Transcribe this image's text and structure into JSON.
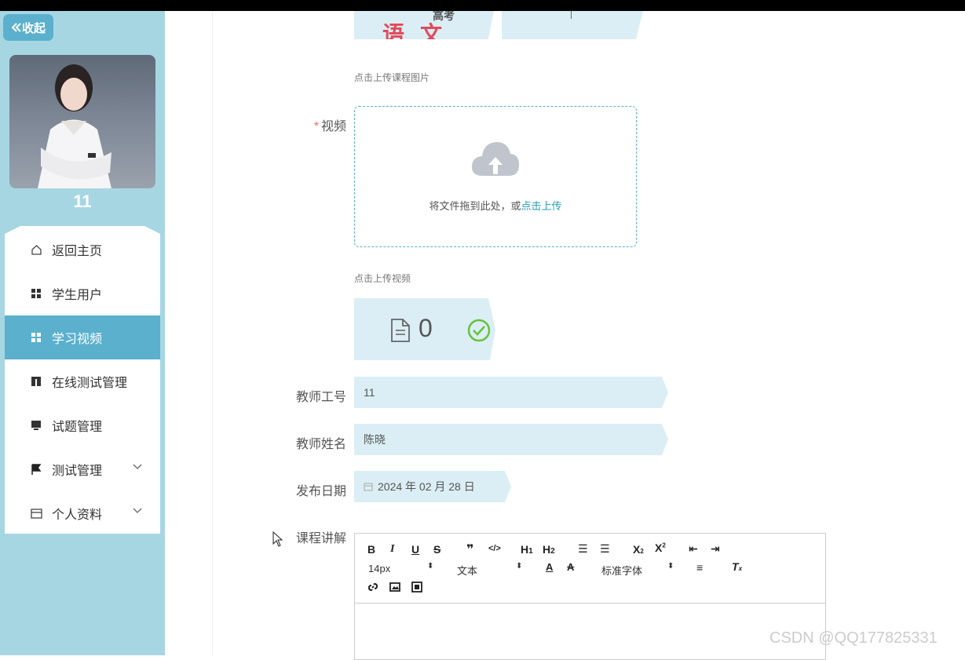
{
  "sidebar": {
    "collapse_label": "收起",
    "username": "11",
    "menu": [
      {
        "label": "返回主页",
        "icon": "home-icon"
      },
      {
        "label": "学生用户",
        "icon": "grid-icon"
      },
      {
        "label": "学习视频",
        "icon": "grid-icon",
        "active": true
      },
      {
        "label": "在线测试管理",
        "icon": "book-icon"
      },
      {
        "label": "试题管理",
        "icon": "monitor-icon"
      },
      {
        "label": "测试管理",
        "icon": "flag-icon",
        "expandable": true
      },
      {
        "label": "个人资料",
        "icon": "card-icon",
        "expandable": true
      }
    ]
  },
  "form": {
    "course_image": {
      "thumb_text_small": "高考",
      "thumb_text_big": "语文",
      "hint": "点击上传课程图片"
    },
    "video": {
      "label": "视频",
      "required": true,
      "drop_text": "将文件拖到此处，或",
      "drop_link": "点击上传",
      "hint": "点击上传视频",
      "file_count": "0"
    },
    "teacher_id": {
      "label": "教师工号",
      "value": "11"
    },
    "teacher_name": {
      "label": "教师姓名",
      "value": "陈晓"
    },
    "publish_date": {
      "label": "发布日期",
      "value": "2024 年 02 月 28 日"
    },
    "course_desc": {
      "label": "课程讲解",
      "toolbar": {
        "font_size": "14px",
        "text_style": "文本",
        "font_family": "标准字体"
      }
    }
  },
  "watermark": "CSDN @QQ177825331",
  "colors": {
    "sidebar_bg": "#a7d6e3",
    "accent": "#5ab0cd",
    "field_bg": "#dbeef5",
    "required": "#f56c6c",
    "link": "#26a0b4"
  }
}
